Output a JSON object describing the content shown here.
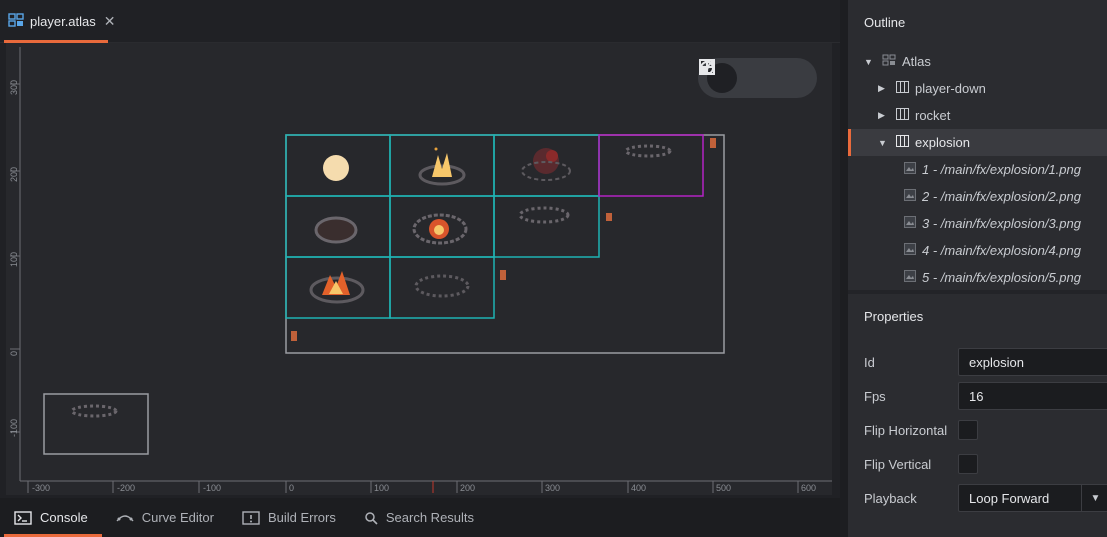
{
  "editor": {
    "tab": {
      "title": "player.atlas",
      "close": "✕"
    },
    "tools": [
      "move-tool",
      "rotate-tool",
      "scale-tool"
    ],
    "ruler": {
      "x_labels": [
        "-300",
        "-200",
        "-100",
        "0",
        "100",
        "200",
        "300",
        "400",
        "500",
        "600"
      ],
      "y_labels": [
        "300",
        "200",
        "100",
        "0",
        "-100"
      ]
    }
  },
  "bottom_tabs": [
    {
      "label": "Console",
      "icon": "console-icon"
    },
    {
      "label": "Curve Editor",
      "icon": "curve-icon"
    },
    {
      "label": "Build Errors",
      "icon": "error-icon"
    },
    {
      "label": "Search Results",
      "icon": "search-icon"
    }
  ],
  "outline": {
    "title": "Outline",
    "items": [
      {
        "label": "Atlas",
        "icon": "atlas-icon",
        "arrow": "▼"
      },
      {
        "label": "player-down",
        "icon": "animation-icon",
        "arrow": "▶"
      },
      {
        "label": "rocket",
        "icon": "animation-icon",
        "arrow": "▶"
      },
      {
        "label": "explosion",
        "icon": "animation-icon",
        "arrow": "▼"
      },
      {
        "label": "1 - /main/fx/explosion/1.png",
        "icon": "image-icon"
      },
      {
        "label": "2 - /main/fx/explosion/2.png",
        "icon": "image-icon"
      },
      {
        "label": "3 - /main/fx/explosion/3.png",
        "icon": "image-icon"
      },
      {
        "label": "4 - /main/fx/explosion/4.png",
        "icon": "image-icon"
      },
      {
        "label": "5 - /main/fx/explosion/5.png",
        "icon": "image-icon"
      }
    ]
  },
  "properties": {
    "title": "Properties",
    "id": {
      "label": "Id",
      "value": "explosion"
    },
    "fps": {
      "label": "Fps",
      "value": "16"
    },
    "flip_h": {
      "label": "Flip Horizontal",
      "checked": false
    },
    "flip_v": {
      "label": "Flip Vertical",
      "checked": false
    },
    "playback": {
      "label": "Playback",
      "value": "Loop Forward"
    }
  },
  "colors": {
    "accent": "#e96a3c",
    "frame_outline": "#1fb3b3",
    "selected_outline": "#b322c4",
    "atlas_outline": "#9a9ca2"
  }
}
